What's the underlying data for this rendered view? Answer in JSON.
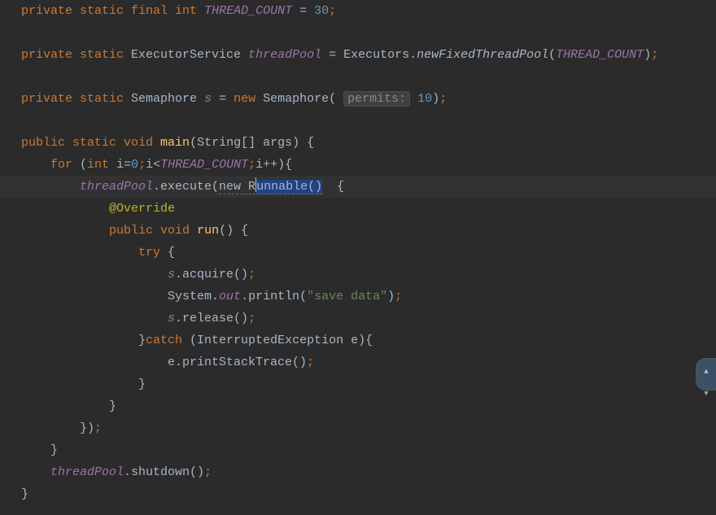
{
  "code": {
    "l1": {
      "kw1": "private static final int",
      "field": "THREAD_COUNT",
      "eq": " = ",
      "num": "30",
      "semi": ";"
    },
    "l2": "",
    "l3": {
      "kw1": "private static",
      "type": " ExecutorService ",
      "field": "threadPool",
      "eq": " = Executors.",
      "smthd": "newFixedThreadPool",
      "lp": "(",
      "arg": "THREAD_COUNT",
      "rp": ")",
      "semi": ";"
    },
    "l4": "",
    "l5": {
      "kw1": "private static",
      "type": " Semaphore ",
      "field": "s",
      "eq": " = ",
      "kw2": "new",
      "cls": " Semaphore( ",
      "hint": "permits:",
      "num": "10",
      "tail": ")",
      "semi": ";"
    },
    "l6": "",
    "l7": {
      "kw1": "public static void",
      "mth": "main",
      "args": "(String[] args) {"
    },
    "l8": {
      "ind": "    ",
      "kw1": "for",
      "lp": " (",
      "kw2": "int",
      "var": " i=",
      "num0": "0",
      "semi1": ";",
      "cond1": "i<",
      "const": "THREAD_COUNT",
      "semi2": ";",
      "inc": "i++){"
    },
    "l9": {
      "ind": "        ",
      "field": "threadPool",
      "dot": ".execute(",
      "sel1": "new R",
      "sel2": "unnable()",
      "tail": "  {"
    },
    "l10": {
      "ind": "            ",
      "ann": "@Override"
    },
    "l11": {
      "ind": "            ",
      "kw1": "public void",
      "mth": "run",
      "args": "() {"
    },
    "l12": {
      "ind": "                ",
      "kw1": "try",
      "br": " {"
    },
    "l13": {
      "ind": "                    ",
      "field": "s",
      "call": ".acquire()",
      "semi": ";"
    },
    "l14": {
      "ind": "                    System.",
      "out": "out",
      "call": ".println(",
      "str": "\"save data\"",
      "rp": ")",
      "semi": ";"
    },
    "l15": {
      "ind": "                    ",
      "field": "s",
      "call": ".release()",
      "semi": ";"
    },
    "l16": {
      "ind": "                }",
      "kw1": "catch",
      "args": " (InterruptedException e){"
    },
    "l17": {
      "ind": "                    e.printStackTrace()",
      "semi": ";"
    },
    "l18": {
      "ind": "                }"
    },
    "l19": {
      "ind": "            }"
    },
    "l20": {
      "ind": "        })",
      "semi": ";"
    },
    "l21": {
      "ind": "    }"
    },
    "l22": {
      "ind": "    ",
      "field": "threadPool",
      "call": ".shutdown()",
      "semi": ";"
    },
    "l23": {
      "ind": "}"
    }
  }
}
